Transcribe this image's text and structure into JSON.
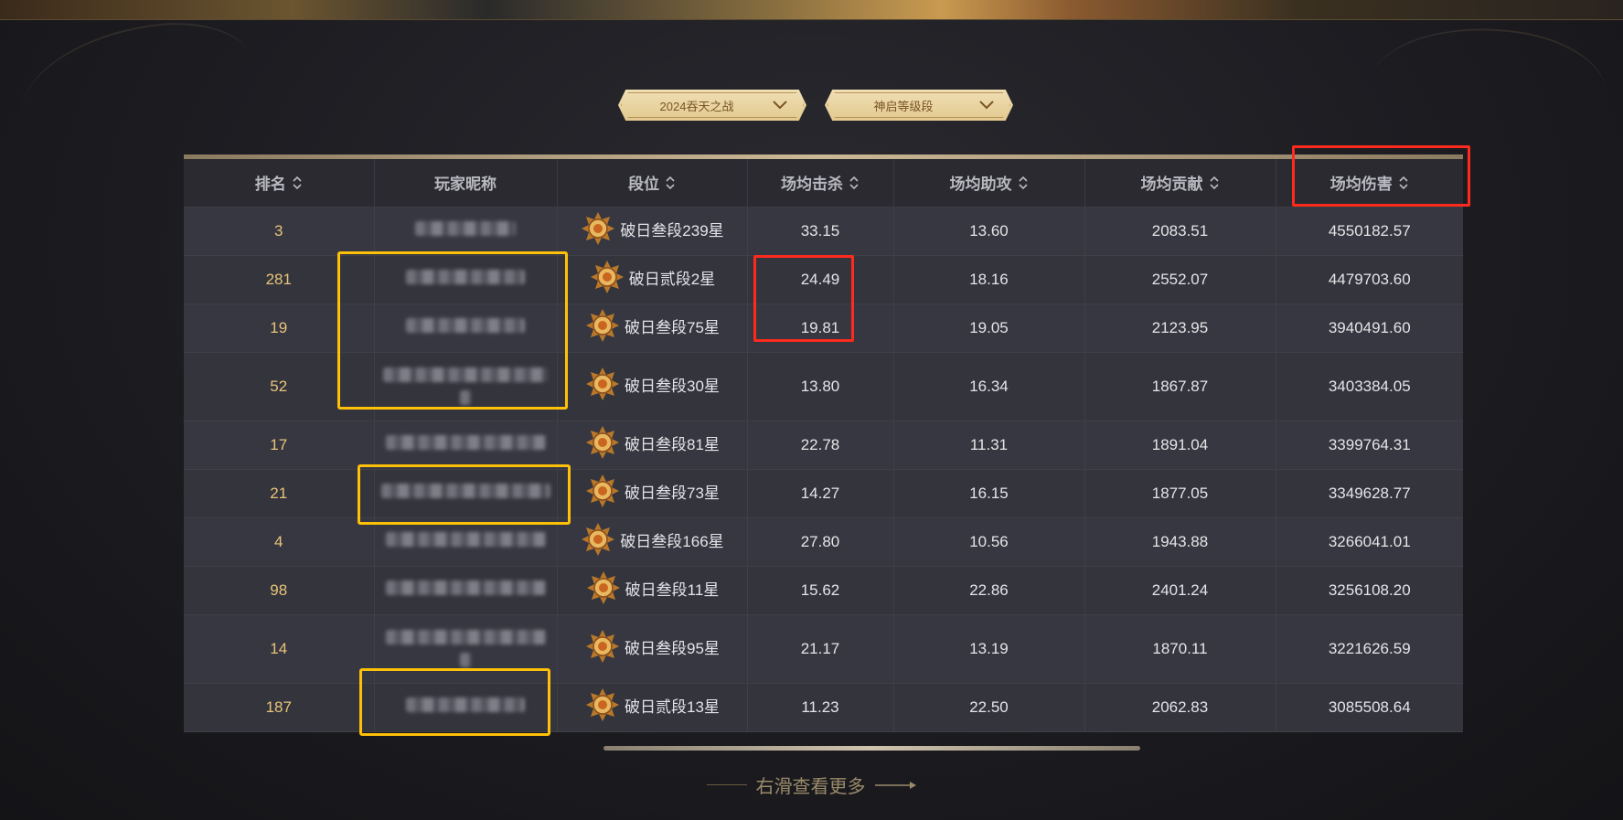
{
  "filters": [
    {
      "label": "2024吞天之战"
    },
    {
      "label": "神启等级段"
    }
  ],
  "table": {
    "columns": [
      "排名",
      "玩家昵称",
      "段位",
      "场均击杀",
      "场均助攻",
      "场均贡献",
      "场均伤害"
    ],
    "rows": [
      {
        "rank": "3",
        "tier": "破日叁段239星",
        "kills": "33.15",
        "assists": "13.60",
        "contribution": "2083.51",
        "damage": "4550182.57"
      },
      {
        "rank": "281",
        "tier": "破日贰段2星",
        "kills": "24.49",
        "assists": "18.16",
        "contribution": "2552.07",
        "damage": "4479703.60"
      },
      {
        "rank": "19",
        "tier": "破日叁段75星",
        "kills": "19.81",
        "assists": "19.05",
        "contribution": "2123.95",
        "damage": "3940491.60"
      },
      {
        "rank": "52",
        "tier": "破日叁段30星",
        "kills": "13.80",
        "assists": "16.34",
        "contribution": "1867.87",
        "damage": "3403384.05"
      },
      {
        "rank": "17",
        "tier": "破日叁段81星",
        "kills": "22.78",
        "assists": "11.31",
        "contribution": "1891.04",
        "damage": "3399764.31"
      },
      {
        "rank": "21",
        "tier": "破日叁段73星",
        "kills": "14.27",
        "assists": "16.15",
        "contribution": "1877.05",
        "damage": "3349628.77"
      },
      {
        "rank": "4",
        "tier": "破日叁段166星",
        "kills": "27.80",
        "assists": "10.56",
        "contribution": "1943.88",
        "damage": "3266041.01"
      },
      {
        "rank": "98",
        "tier": "破日叁段11星",
        "kills": "15.62",
        "assists": "22.86",
        "contribution": "2401.24",
        "damage": "3256108.20"
      },
      {
        "rank": "14",
        "tier": "破日叁段95星",
        "kills": "21.17",
        "assists": "13.19",
        "contribution": "1870.11",
        "damage": "3221626.59"
      },
      {
        "rank": "187",
        "tier": "破日贰段13星",
        "kills": "11.23",
        "assists": "22.50",
        "contribution": "2062.83",
        "damage": "3085508.64"
      }
    ]
  },
  "footer": {
    "more_label": "右滑查看更多"
  },
  "icons": {
    "sort": "sort-updown-icon",
    "dropdown": "chevron-down-icon",
    "badge": "rank-badge-icon",
    "arrow": "arrow-right-icon"
  },
  "colors": {
    "accent_gold": "#e8c479",
    "highlight_red": "#ff2a1e",
    "highlight_yellow": "#ffc108"
  }
}
